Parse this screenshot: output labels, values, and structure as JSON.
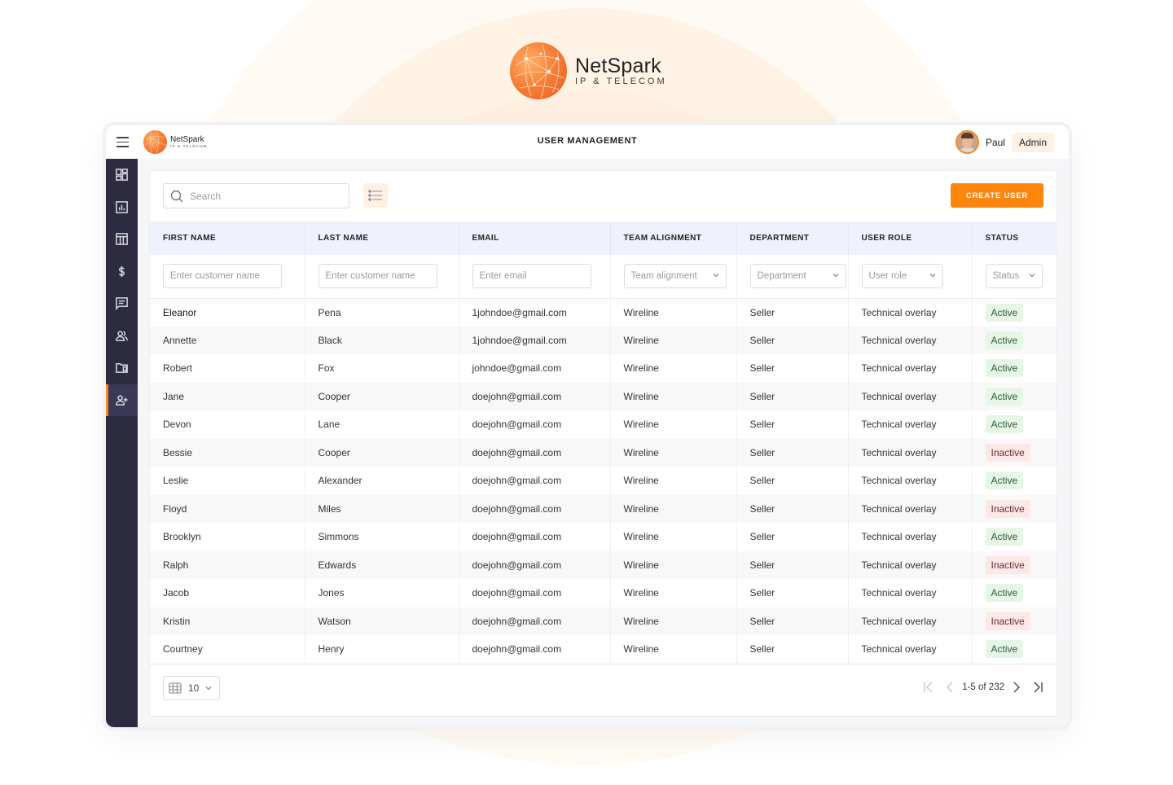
{
  "brand": {
    "name": "NetSpark",
    "tagline": "IP & TELECOM",
    "accent_color": "#ff860d"
  },
  "header": {
    "menu_icon": "hamburger-icon",
    "title": "USER MANAGEMENT",
    "user": {
      "name": "Paul",
      "role": "Admin"
    }
  },
  "sidebar": {
    "items": [
      {
        "icon": "dashboard-icon",
        "active": false
      },
      {
        "icon": "bar-chart-icon",
        "active": false
      },
      {
        "icon": "table-layout-icon",
        "active": false
      },
      {
        "icon": "dollar-icon",
        "active": false
      },
      {
        "icon": "message-icon",
        "active": false
      },
      {
        "icon": "team-icon",
        "active": false
      },
      {
        "icon": "folder-icon",
        "active": false
      },
      {
        "icon": "add-user-icon",
        "active": true
      }
    ]
  },
  "toolbar": {
    "search_placeholder": "Search",
    "search_value": "",
    "list_view_icon": "list-icon",
    "create_label": "CREATE USER"
  },
  "table": {
    "columns": [
      "FIRST NAME",
      "LAST NAME",
      "EMAIL",
      "TEAM ALIGNMENT",
      "DEPARTMENT",
      "USER ROLE",
      "STATUS"
    ],
    "filters": {
      "first_name_placeholder": "Enter customer name",
      "last_name_placeholder": "Enter customer name",
      "email_placeholder": "Enter email",
      "team_alignment": "Team alignment",
      "department": "Department",
      "user_role": "User role",
      "status": "Status"
    },
    "rows": [
      {
        "first": "Eleanor",
        "last": "Pena",
        "email": "1johndoe@gmail.com",
        "team": "Wireline",
        "dept": "Seller",
        "role": "Technical overlay",
        "status": "Active"
      },
      {
        "first": "Annette",
        "last": "Black",
        "email": "1johndoe@gmail.com",
        "team": "Wireline",
        "dept": "Seller",
        "role": "Technical overlay",
        "status": "Active"
      },
      {
        "first": "Robert",
        "last": "Fox",
        "email": "johndoe@gmail.com",
        "team": "Wireline",
        "dept": "Seller",
        "role": "Technical overlay",
        "status": "Active"
      },
      {
        "first": "Jane",
        "last": "Cooper",
        "email": "doejohn@gmail.com",
        "team": "Wireline",
        "dept": "Seller",
        "role": "Technical overlay",
        "status": "Active"
      },
      {
        "first": "Devon",
        "last": "Lane",
        "email": "doejohn@gmail.com",
        "team": "Wireline",
        "dept": "Seller",
        "role": "Technical overlay",
        "status": "Active"
      },
      {
        "first": "Bessie",
        "last": "Cooper",
        "email": "doejohn@gmail.com",
        "team": "Wireline",
        "dept": "Seller",
        "role": "Technical overlay",
        "status": "Inactive"
      },
      {
        "first": "Leslie",
        "last": "Alexander",
        "email": "doejohn@gmail.com",
        "team": "Wireline",
        "dept": "Seller",
        "role": "Technical overlay",
        "status": "Active"
      },
      {
        "first": "Floyd",
        "last": "Miles",
        "email": "doejohn@gmail.com",
        "team": "Wireline",
        "dept": "Seller",
        "role": "Technical overlay",
        "status": "Inactive"
      },
      {
        "first": "Brooklyn",
        "last": "Simmons",
        "email": "doejohn@gmail.com",
        "team": "Wireline",
        "dept": "Seller",
        "role": "Technical overlay",
        "status": "Active"
      },
      {
        "first": "Ralph",
        "last": "Edwards",
        "email": "doejohn@gmail.com",
        "team": "Wireline",
        "dept": "Seller",
        "role": "Technical overlay",
        "status": "Inactive"
      },
      {
        "first": "Jacob",
        "last": "Jones",
        "email": "doejohn@gmail.com",
        "team": "Wireline",
        "dept": "Seller",
        "role": "Technical overlay",
        "status": "Active"
      },
      {
        "first": "Kristin",
        "last": "Watson",
        "email": "doejohn@gmail.com",
        "team": "Wireline",
        "dept": "Seller",
        "role": "Technical overlay",
        "status": "Inactive"
      },
      {
        "first": "Courtney",
        "last": "Henry",
        "email": "doejohn@gmail.com",
        "team": "Wireline",
        "dept": "Seller",
        "role": "Technical overlay",
        "status": "Active"
      }
    ]
  },
  "footer": {
    "page_size": "10",
    "range_text": "1-5 of 232"
  },
  "status_colors": {
    "active_bg": "#e6f6e6",
    "inactive_bg": "#fde8e8"
  }
}
